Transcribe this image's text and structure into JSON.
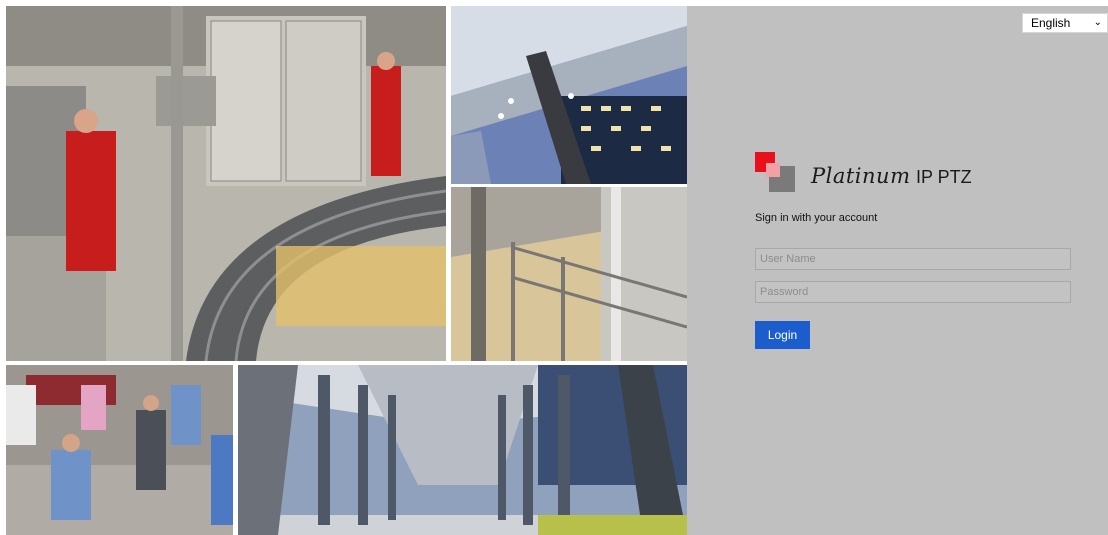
{
  "language": {
    "selected": "English"
  },
  "brand": {
    "script_name": "Platinum",
    "model": "IP PTZ"
  },
  "login": {
    "subtitle": "Sign in with your account",
    "username_placeholder": "User Name",
    "password_placeholder": "Password",
    "button_label": "Login"
  },
  "colors": {
    "panel_bg": "#c0c0c0",
    "button_bg": "#1b5dcc",
    "logo_red": "#e8101a",
    "logo_pink": "#f0a0a6",
    "logo_gray": "#7a7a7a"
  },
  "icons": {
    "language_dropdown": "chevron-down-icon"
  }
}
